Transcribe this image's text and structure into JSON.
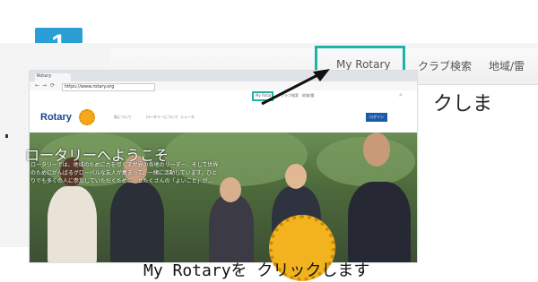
{
  "step": {
    "number": "1"
  },
  "zoom": {
    "nav": [
      "My Rotary",
      "クラブ検索",
      "地域/雷"
    ],
    "right_text": "クしま"
  },
  "browser": {
    "tab_title": "Rotary",
    "url": "https://www.rotary.org"
  },
  "site": {
    "top_nav": [
      "My Rotary",
      "クラブ検索",
      "地域/雷"
    ],
    "logo": "Rotary",
    "header_nav": [
      "私について",
      "ロータリーについて",
      "ニュース"
    ],
    "login_label": "ログイン",
    "hero_title": "ロータリーへようこそ",
    "hero_body": "ロータリーでは、地域のために力を尽くす世界の各地のリーダー、そして世界のためにがんばるグローバルな友人が集まって、一緒に活動しています。ひとりでも多くの人に参加していただくために、とたくさんの「よいこと」が..."
  },
  "caption": "My Rotaryを クリックします",
  "colors": {
    "accent": "#1fb3a6",
    "badge": "#2a9fd6",
    "rotary_blue": "#17458f",
    "rotary_gold": "#f7a81b"
  }
}
